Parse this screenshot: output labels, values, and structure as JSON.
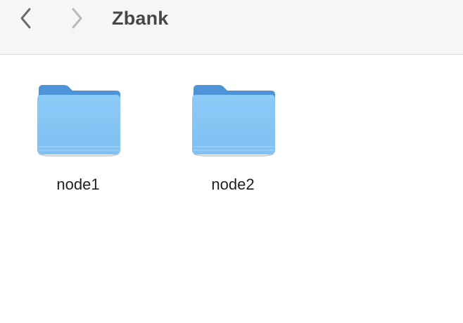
{
  "toolbar": {
    "title": "Zbank",
    "back_icon": "chevron-left-icon",
    "forward_icon": "chevron-right-icon"
  },
  "items": [
    {
      "label": "node1",
      "icon": "folder-icon"
    },
    {
      "label": "node2",
      "icon": "folder-icon"
    }
  ],
  "colors": {
    "folder_tab": "#4a90d9",
    "folder_front": "#86c5f5",
    "toolbar_bg": "#f6f6f6",
    "title_text": "#474747"
  }
}
